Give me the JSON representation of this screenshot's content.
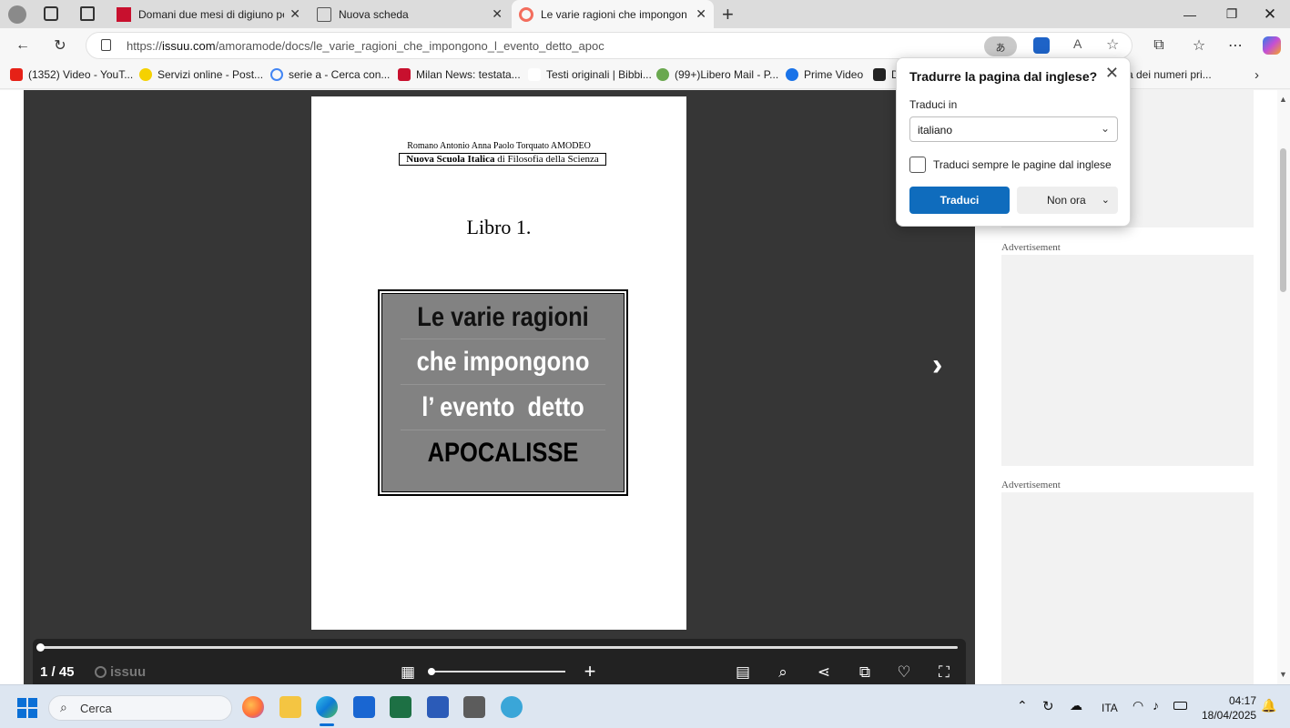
{
  "tabs": [
    {
      "label": "Domani due mesi di digiuno per C",
      "icon": "milan-news-icon",
      "active": false
    },
    {
      "label": "Nuova scheda",
      "icon": "new-tab-icon",
      "active": false
    },
    {
      "label": "Le varie ragioni che impongono l'",
      "icon": "issuu-icon",
      "active": true
    }
  ],
  "address": {
    "url_prefix": "https://",
    "url_host": "issuu.com",
    "url_path": "/amoramode/docs/le_varie_ragioni_che_impongono_l_evento_detto_apoc"
  },
  "bookmarks": [
    {
      "label": "(1352) Video - YouT...",
      "color": "#e62117"
    },
    {
      "label": "Servizi online - Post...",
      "color": "#f5d100"
    },
    {
      "label": "serie a - Cerca con...",
      "color": "#4285f4"
    },
    {
      "label": "Milan News: testata...",
      "color": "#c8102e"
    },
    {
      "label": "Testi originali | Bibbi...",
      "color": "#ffffff"
    },
    {
      "label": "(99+)Libero Mail - P...",
      "color": "#6aa84f"
    },
    {
      "label": "Prime Video",
      "color": "#1a73e8"
    },
    {
      "label": "D",
      "color": "#222222"
    },
    {
      "label": "a dei numeri pri...",
      "color": "#f7f7f7"
    }
  ],
  "document": {
    "author": "Romano Antonio Anna Paolo Torquato AMODEO",
    "school_bold": "Nuova Scuola Italica",
    "school_rest": " di Filosofia della Scienza",
    "book": "Libro 1.",
    "title_lines": [
      "Le varie ragioni",
      "che impongono",
      "l’ evento  detto",
      "APOCALISSE"
    ]
  },
  "viewer": {
    "page_indicator": "1 / 45",
    "brand": "issuu"
  },
  "ads": {
    "label1": "Advertisement",
    "label2": "Advertisement"
  },
  "translate_popup": {
    "title": "Tradurre la pagina dal inglese?",
    "translate_to_label": "Traduci in",
    "language": "italiano",
    "always_label": "Traduci sempre le pagine dal inglese",
    "translate_button": "Traduci",
    "not_now_button": "Non ora"
  },
  "taskbar": {
    "search_placeholder": "Cerca",
    "language": "ITA",
    "time": "04:17",
    "date": "18/04/2025"
  }
}
